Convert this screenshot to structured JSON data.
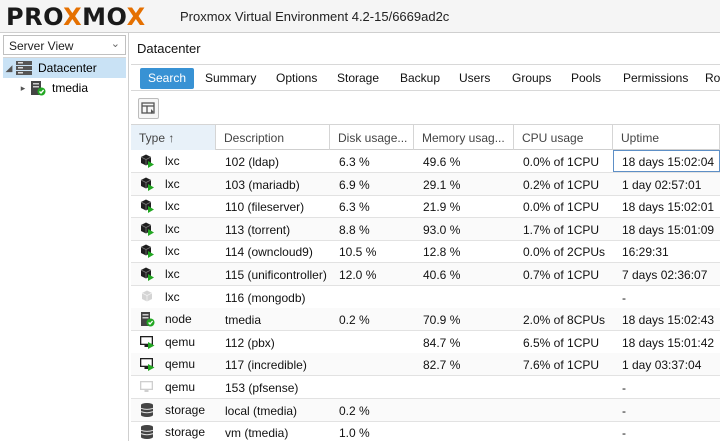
{
  "header": {
    "logo_pre": "PRO",
    "logo_x1": "X",
    "logo_mid": "MO",
    "logo_x2": "X",
    "version": "Proxmox Virtual Environment 4.2-15/6669ad2c"
  },
  "leftpanel": {
    "view": "Server View",
    "tree": [
      {
        "label": "Datacenter",
        "icon": "datacenter-icon",
        "selected": true
      },
      {
        "label": "tmedia",
        "icon": "node-online-icon",
        "selected": false
      }
    ]
  },
  "main": {
    "breadcrumb": "Datacenter",
    "tabs": [
      "Search",
      "Summary",
      "Options",
      "Storage",
      "Backup",
      "Users",
      "Groups",
      "Pools",
      "Permissions",
      "Ro"
    ],
    "active_tab": "Search"
  },
  "grid": {
    "columns": [
      "Type ↑",
      "Description",
      "Disk usage...",
      "Memory usag...",
      "CPU usage",
      "Uptime"
    ],
    "rows": [
      {
        "type": "lxc",
        "icon": "container-running-icon",
        "description": "102 (ldap)",
        "disk": "6.3 %",
        "memory": "49.6 %",
        "cpu": "0.0% of 1CPU",
        "uptime": "18 days 15:02:04"
      },
      {
        "type": "lxc",
        "icon": "container-running-icon",
        "description": "103 (mariadb)",
        "disk": "6.9 %",
        "memory": "29.1 %",
        "cpu": "0.2% of 1CPU",
        "uptime": "1 day 02:57:01"
      },
      {
        "type": "lxc",
        "icon": "container-running-icon",
        "description": "110 (fileserver)",
        "disk": "6.3 %",
        "memory": "21.9 %",
        "cpu": "0.0% of 1CPU",
        "uptime": "18 days 15:02:01"
      },
      {
        "type": "lxc",
        "icon": "container-running-icon",
        "description": "113 (torrent)",
        "disk": "8.8 %",
        "memory": "93.0 %",
        "cpu": "1.7% of 1CPU",
        "uptime": "18 days 15:01:09"
      },
      {
        "type": "lxc",
        "icon": "container-running-icon",
        "description": "114 (owncloud9)",
        "disk": "10.5 %",
        "memory": "12.8 %",
        "cpu": "0.0% of 2CPUs",
        "uptime": "16:29:31"
      },
      {
        "type": "lxc",
        "icon": "container-running-icon",
        "description": "115 (unificontroller)",
        "disk": "12.0 %",
        "memory": "40.6 %",
        "cpu": "0.7% of 1CPU",
        "uptime": "7 days 02:36:07"
      },
      {
        "type": "lxc",
        "icon": "container-stopped-icon",
        "description": "116 (mongodb)",
        "disk": "",
        "memory": "",
        "cpu": "",
        "uptime": "-"
      },
      {
        "type": "node",
        "icon": "node-online-icon",
        "description": "tmedia",
        "disk": "0.2 %",
        "memory": "70.9 %",
        "cpu": "2.0% of 8CPUs",
        "uptime": "18 days 15:02:43"
      },
      {
        "type": "qemu",
        "icon": "vm-running-icon",
        "description": "112 (pbx)",
        "disk": "",
        "memory": "84.7 %",
        "cpu": "6.5% of 1CPU",
        "uptime": "18 days 15:01:42"
      },
      {
        "type": "qemu",
        "icon": "vm-running-icon",
        "description": "117 (incredible)",
        "disk": "",
        "memory": "82.7 %",
        "cpu": "7.6% of 1CPU",
        "uptime": "1 day 03:37:04"
      },
      {
        "type": "qemu",
        "icon": "vm-stopped-icon",
        "description": "153 (pfsense)",
        "disk": "",
        "memory": "",
        "cpu": "",
        "uptime": "-"
      },
      {
        "type": "storage",
        "icon": "storage-icon",
        "description": "local (tmedia)",
        "disk": "0.2 %",
        "memory": "",
        "cpu": "",
        "uptime": "-"
      },
      {
        "type": "storage",
        "icon": "storage-icon",
        "description": "vm (tmedia)",
        "disk": "1.0 %",
        "memory": "",
        "cpu": "",
        "uptime": "-"
      }
    ]
  },
  "colors": {
    "accent": "#3892d4",
    "logo_x": "#e57000",
    "running_green": "#22a722",
    "selected_row": "#c9e2f5"
  }
}
